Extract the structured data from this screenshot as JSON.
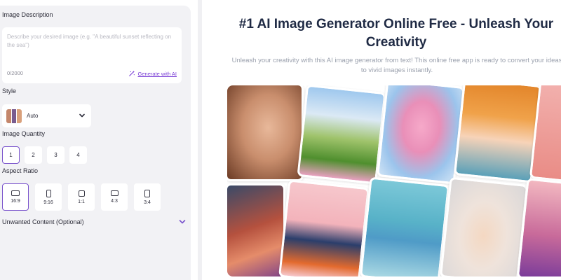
{
  "left_panel": {
    "image_description": {
      "label": "Image Description",
      "placeholder": "Describe your desired image (e.g. \"A beautiful sunset reflecting on the sea\")",
      "char_count": "0/2000",
      "generate_label": "Generate with AI",
      "generate_icon": "magic-wand-icon"
    },
    "style": {
      "label": "Style",
      "selected": "Auto"
    },
    "image_quantity": {
      "label": "Image Quantity",
      "options": [
        "1",
        "2",
        "3",
        "4"
      ],
      "selected": "1"
    },
    "aspect_ratio": {
      "label": "Aspect Ratio",
      "options": [
        "16:9",
        "9:16",
        "1:1",
        "4:3",
        "3:4"
      ],
      "selected": "16:9"
    },
    "unwanted_content": {
      "label": "Unwanted Content (Optional)"
    }
  },
  "main": {
    "title": "#1 AI Image Generator Online Free - Unleash Your Creativity",
    "subtitle": "Unleash your creativity with this AI image generator from text! This online free app is ready to convert your ideas to vivid images instantly."
  },
  "colors": {
    "accent": "#7a54cc",
    "link": "#7a3fd6",
    "title": "#1f2a44",
    "panel_bg": "#f2f2f5"
  }
}
